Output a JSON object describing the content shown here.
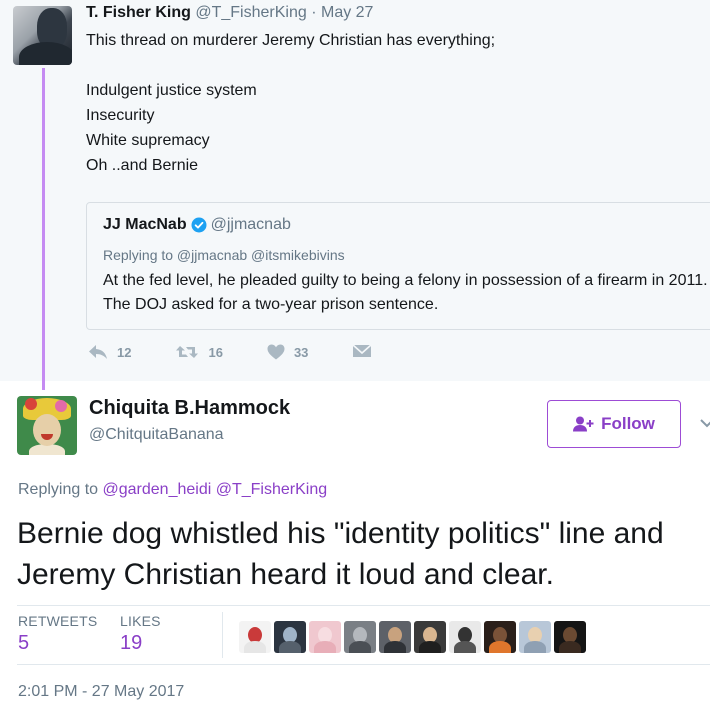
{
  "parent_tweet": {
    "name": "T. Fisher King",
    "handle": "@T_FisherKing",
    "separator": "·",
    "date": "May 27",
    "lines": [
      "This thread on murderer Jeremy Christian has everything;",
      "",
      "Indulgent justice system",
      "Insecurity",
      "White supremacy",
      "Oh ..and Bernie"
    ],
    "quote": {
      "name": "JJ MacNab",
      "handle": "@jjmacnab",
      "replying": "Replying to @jjmacnab @itsmikebivins",
      "text": "At the fed level, he pleaded guilty to being a felony in possession of a firearm in 2011. The DOJ asked for a two-year prison sentence."
    },
    "actions": {
      "replies": "12",
      "retweets": "16",
      "likes": "33"
    }
  },
  "main_tweet": {
    "name": "Chiquita B.Hammock",
    "handle": "@ChitquitaBanana",
    "follow_label": "Follow",
    "replying_prefix": "Replying to",
    "replying_to": [
      "@garden_heidi",
      "@T_FisherKing"
    ],
    "text": "Bernie dog whistled his \"identity politics\" line and Jeremy Christian heard it loud and clear.",
    "stats": {
      "retweets_label": "RETWEETS",
      "retweets": "5",
      "likes_label": "LIKES",
      "likes": "19"
    },
    "timestamp": "2:01 PM - 27 May 2017"
  },
  "colors": {
    "accent": "#8a3fc7",
    "thread_line": "#c58bf2",
    "muted": "#657786",
    "verified": "#1da1f2"
  },
  "icons": [
    "reply-icon",
    "retweet-icon",
    "heart-icon",
    "direct-message-icon",
    "verified-badge-icon",
    "follow-person-icon",
    "caret-down-icon"
  ]
}
